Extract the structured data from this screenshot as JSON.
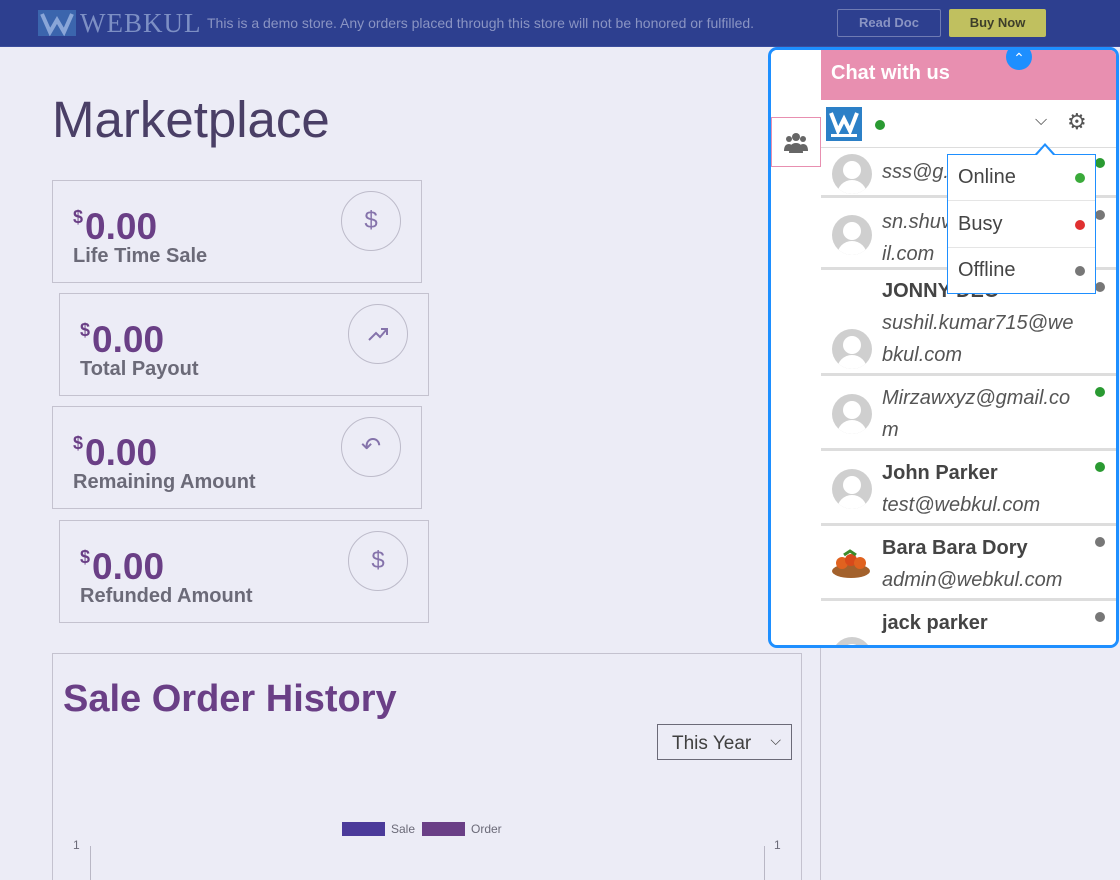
{
  "topbar": {
    "logo_text": "WEBKUL",
    "demo_note": "This is a demo store. Any orders placed through this store will not be honored or fulfilled.",
    "read_doc": "Read Doc",
    "buy_now": "Buy Now"
  },
  "page": {
    "title": "Marketplace"
  },
  "cards": [
    {
      "currency": "$",
      "amount": "0.00",
      "label": "Life Time Sale",
      "icon": "dollar-icon"
    },
    {
      "currency": "$",
      "amount": "0.00",
      "label": "Total Payout",
      "icon": "trend-up-icon"
    },
    {
      "currency": "$",
      "amount": "0.00",
      "label": "Remaining Amount",
      "icon": "undo-icon"
    },
    {
      "currency": "$",
      "amount": "0.00",
      "label": "Refunded Amount",
      "icon": "dollar-icon"
    }
  ],
  "sale_history": {
    "title": "Sale Order History",
    "period_select": "This Year",
    "legend": [
      {
        "name": "Sale",
        "color": "#4b3a9a"
      },
      {
        "name": "Order",
        "color": "#6a3f86"
      }
    ],
    "left_tick": "1",
    "right_tick": "1"
  },
  "chat": {
    "title": "Chat with us",
    "agent_status_color": "#2a9a32",
    "status_options": [
      {
        "label": "Online",
        "color": "#3aaa3a"
      },
      {
        "label": "Busy",
        "color": "#e03030"
      },
      {
        "label": "Offline",
        "color": "#777777"
      }
    ],
    "users": [
      {
        "name": "",
        "email": "sss@g...",
        "status_color": "#2a9a32",
        "avatar": "default-avatar"
      },
      {
        "name": "",
        "email": "sn.shuv…il.com",
        "email_line1": "sn.shuv",
        "email_line2": "il.com",
        "status_color": "#777777",
        "avatar": "default-avatar"
      },
      {
        "name": "JONNY DEO",
        "email": "sushil.kumar715@webkul.com",
        "status_color": "#777777",
        "avatar": "default-avatar"
      },
      {
        "name": "",
        "email": "Mirzawxyz@gmail.com",
        "status_color": "#2a9a32",
        "avatar": "default-avatar"
      },
      {
        "name": "John Parker",
        "email": "test@webkul.com",
        "status_color": "#2a9a32",
        "avatar": "default-avatar"
      },
      {
        "name": "Bara Bara Dory",
        "email": "admin@webkul.com",
        "status_color": "#777777",
        "avatar": "food-avatar"
      },
      {
        "name": "jack parker",
        "email": "",
        "status_color": "#777777",
        "avatar": "default-avatar"
      }
    ]
  }
}
